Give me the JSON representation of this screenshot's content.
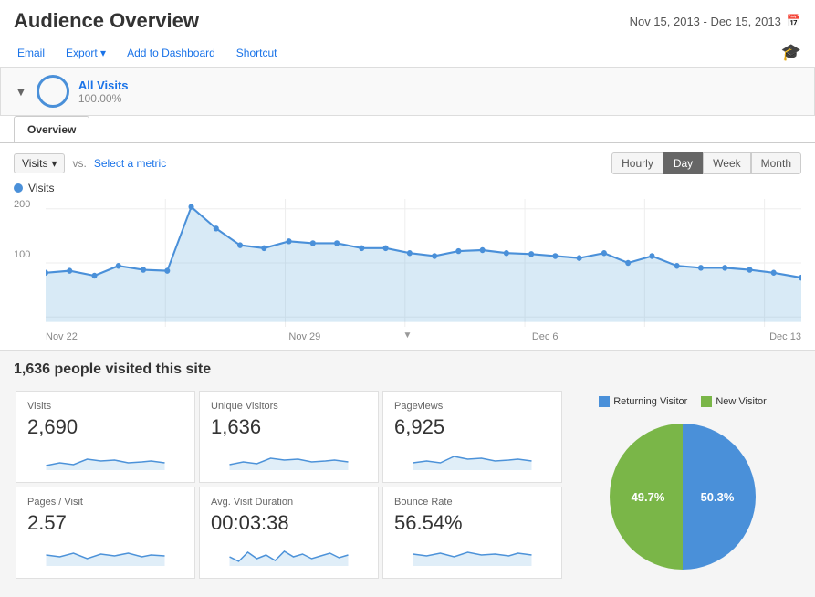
{
  "header": {
    "title": "Audience Overview",
    "date_range": "Nov 15, 2013 - Dec 15, 2013",
    "calendar_icon": "📅"
  },
  "toolbar": {
    "email_label": "Email",
    "export_label": "Export",
    "add_to_dashboard_label": "Add to Dashboard",
    "shortcut_label": "Shortcut",
    "help_icon": "🎓"
  },
  "segment": {
    "name": "All Visits",
    "percentage": "100.00%"
  },
  "tabs": [
    {
      "label": "Overview",
      "active": true
    }
  ],
  "chart_controls": {
    "metric_label": "Visits",
    "vs_label": "vs.",
    "select_metric_label": "Select a metric",
    "time_buttons": [
      {
        "label": "Hourly",
        "active": false
      },
      {
        "label": "Day",
        "active": true
      },
      {
        "label": "Week",
        "active": false
      },
      {
        "label": "Month",
        "active": false
      }
    ]
  },
  "chart": {
    "legend_label": "Visits",
    "y_label_200": "200",
    "y_label_100": "100",
    "x_labels": [
      "Nov 22",
      "Nov 29",
      "Dec 6",
      "Dec 13"
    ],
    "data_points": [
      95,
      100,
      80,
      85,
      75,
      85,
      200,
      160,
      130,
      125,
      140,
      145,
      140,
      135,
      130,
      125,
      120,
      115,
      115,
      110,
      105,
      110,
      115,
      120,
      110,
      100,
      100,
      95,
      85,
      80,
      75
    ]
  },
  "summary": {
    "headline": "1,636 people visited this site"
  },
  "stats": [
    {
      "label": "Visits",
      "value": "2,690"
    },
    {
      "label": "Unique Visitors",
      "value": "1,636"
    },
    {
      "label": "Pageviews",
      "value": "6,925"
    },
    {
      "label": "Pages / Visit",
      "value": "2.57"
    },
    {
      "label": "Avg. Visit Duration",
      "value": "00:03:38"
    },
    {
      "label": "Bounce Rate",
      "value": "56.54%"
    }
  ],
  "pie_chart": {
    "legend": [
      {
        "label": "Returning Visitor",
        "color": "#4a90d9"
      },
      {
        "label": "New Visitor",
        "color": "#7ab648"
      }
    ],
    "segments": [
      {
        "label": "Returning Visitor",
        "percentage": 50.3,
        "color": "#4a90d9"
      },
      {
        "label": "New Visitor",
        "percentage": 49.7,
        "color": "#7ab648"
      }
    ],
    "returning_label": "50.3%",
    "new_label": "49.7%"
  }
}
